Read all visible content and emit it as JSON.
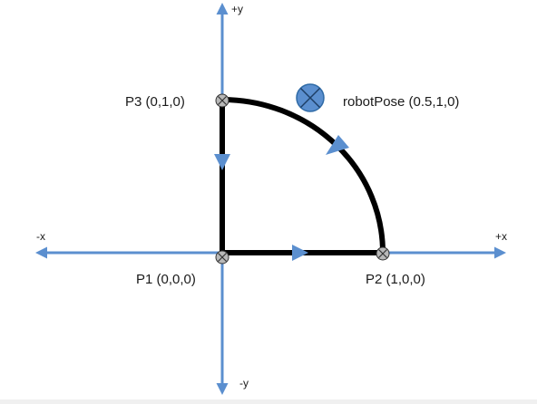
{
  "axes": {
    "pos_y": "+y",
    "neg_y": "-y",
    "pos_x": "+x",
    "neg_x": "-x"
  },
  "points": {
    "p1": "P1 (0,0,0)",
    "p2": "P2 (1,0,0)",
    "p3": "P3 (0,1,0)",
    "robot_pose": "robotPose (0.5,1,0)"
  },
  "colors": {
    "axis": "#5b8fcf",
    "path": "#000000",
    "marker_fill": "#5b8fcf",
    "point_fill": "#b8b8b8",
    "text": "#1a1a1a"
  }
}
